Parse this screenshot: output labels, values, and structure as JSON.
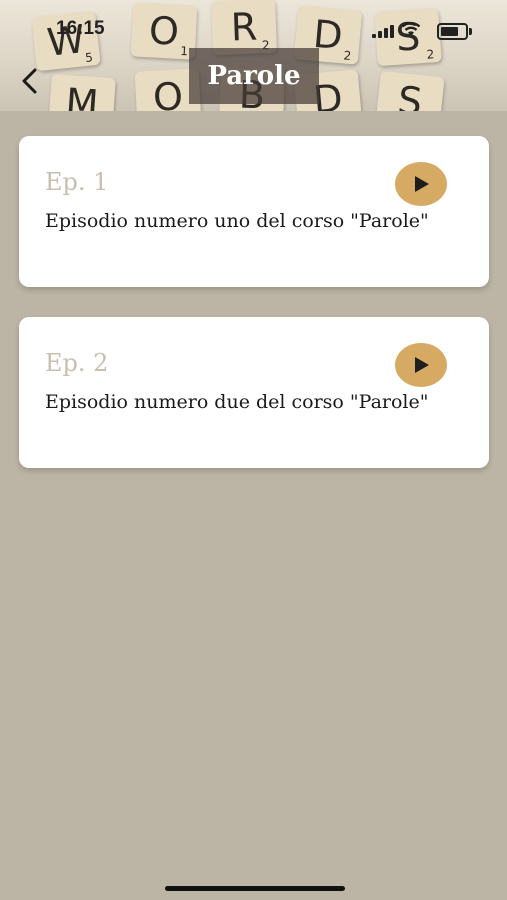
{
  "status_bar": {
    "time": "16:15"
  },
  "header": {
    "title": "Parole",
    "background_tiles": [
      {
        "letter": "W",
        "sub": "5"
      },
      {
        "letter": "O",
        "sub": "1"
      },
      {
        "letter": "R",
        "sub": "2"
      },
      {
        "letter": "D",
        "sub": "2"
      },
      {
        "letter": "S",
        "sub": "2"
      },
      {
        "letter": "M",
        "sub": ""
      },
      {
        "letter": "O",
        "sub": ""
      },
      {
        "letter": "B",
        "sub": ""
      },
      {
        "letter": "D",
        "sub": ""
      },
      {
        "letter": "S",
        "sub": ""
      }
    ]
  },
  "episodes": [
    {
      "label": "Ep. 1",
      "description": "Episodio numero uno del corso \"Parole\""
    },
    {
      "label": "Ep. 2",
      "description": "Episodio numero due del corso \"Parole\""
    }
  ],
  "colors": {
    "background": "#bcb5a5",
    "play_button": "#d6aa63",
    "episode_label": "#c8bfb0"
  }
}
